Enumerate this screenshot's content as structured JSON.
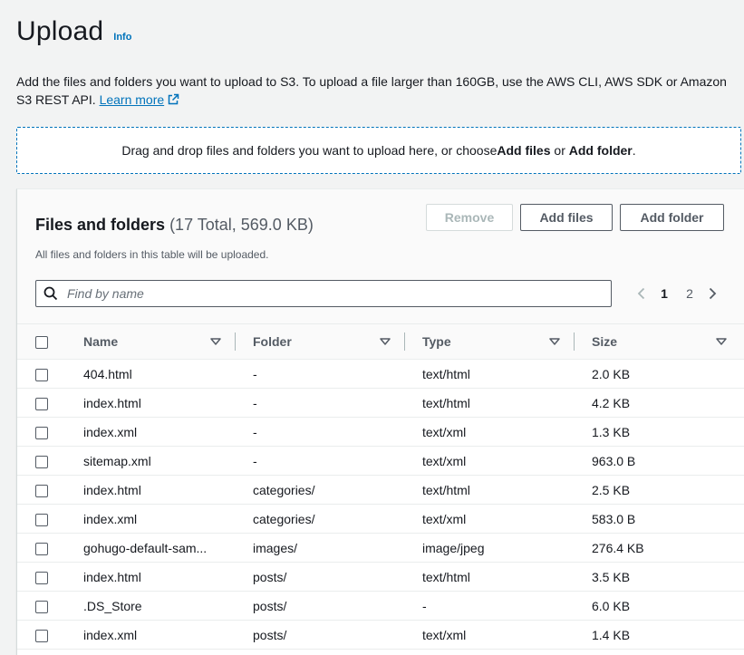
{
  "header": {
    "title": "Upload",
    "info": "Info"
  },
  "description": {
    "text": "Add the files and folders you want to upload to S3. To upload a file larger than 160GB, use the AWS CLI, AWS SDK or Amazon S3 REST API.",
    "learn_more": "Learn more"
  },
  "dropzone": {
    "prefix": "Drag and drop files and folders you want to upload here, or choose ",
    "add_files": "Add files",
    "or": " or ",
    "add_folder": "Add folder",
    "suffix": "."
  },
  "panel": {
    "title": "Files and folders",
    "count": "(17 Total, 569.0 KB)",
    "subtitle": "All files and folders in this table will be uploaded.",
    "remove_label": "Remove",
    "add_files_label": "Add files",
    "add_folder_label": "Add folder",
    "search_placeholder": "Find by name",
    "pages": [
      "1",
      "2"
    ],
    "current_page": "1"
  },
  "table": {
    "columns": [
      "Name",
      "Folder",
      "Type",
      "Size"
    ],
    "rows": [
      {
        "name": "404.html",
        "folder": "-",
        "type": "text/html",
        "size": "2.0 KB"
      },
      {
        "name": "index.html",
        "folder": "-",
        "type": "text/html",
        "size": "4.2 KB"
      },
      {
        "name": "index.xml",
        "folder": "-",
        "type": "text/xml",
        "size": "1.3 KB"
      },
      {
        "name": "sitemap.xml",
        "folder": "-",
        "type": "text/xml",
        "size": "963.0 B"
      },
      {
        "name": "index.html",
        "folder": "categories/",
        "type": "text/html",
        "size": "2.5 KB"
      },
      {
        "name": "index.xml",
        "folder": "categories/",
        "type": "text/xml",
        "size": "583.0 B"
      },
      {
        "name": "gohugo-default-sam...",
        "folder": "images/",
        "type": "image/jpeg",
        "size": "276.4 KB"
      },
      {
        "name": "index.html",
        "folder": "posts/",
        "type": "text/html",
        "size": "3.5 KB"
      },
      {
        "name": ".DS_Store",
        "folder": "posts/",
        "type": "-",
        "size": "6.0 KB"
      },
      {
        "name": "index.xml",
        "folder": "posts/",
        "type": "text/xml",
        "size": "1.4 KB"
      }
    ]
  },
  "colors": {
    "link": "#0073bb",
    "text": "#16191f",
    "muted": "#545b64",
    "background": "#f2f3f3"
  },
  "icons": [
    "external-link-icon",
    "search-icon",
    "chevron-left-icon",
    "chevron-right-icon",
    "sort-caret-icon"
  ]
}
